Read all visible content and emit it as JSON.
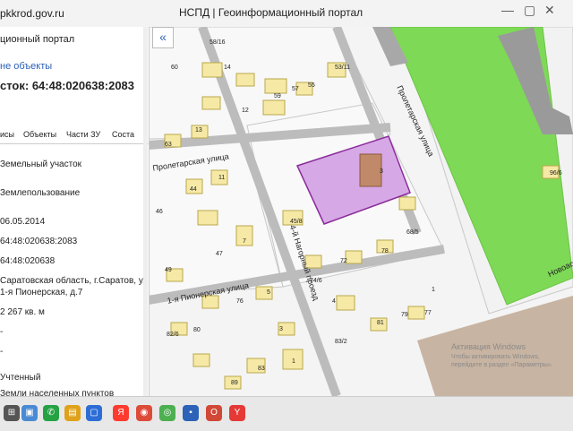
{
  "browser": {
    "url": "pkkrod.gov.ru",
    "title": "НСПД | Геоинформационный портал"
  },
  "panel": {
    "portal": "ционный портал",
    "objects_link": "не объекты",
    "cadastral": "сток: 64:48:020638:2083",
    "tabs": [
      "исы",
      "Объекты",
      "Части ЗУ",
      "Соста"
    ],
    "fields": [
      "Земельный участок",
      "Землепользование",
      "06.05.2014",
      "64:48:020638:2083",
      "64:48:020638",
      "Саратовская область, г.Саратов, ул.",
      "1-я Пионерская, д.7",
      "2 267 кв. м",
      "-",
      "-",
      "Учтенный",
      "Земли населенных пунктов"
    ]
  },
  "map": {
    "streets": [
      "Пролетарская улица",
      "Пролетарская улица",
      "1-я Пионерская улица",
      "4-й Нагорный проезд",
      "Новоас"
    ],
    "parcel_labels": [
      "58/16",
      "14",
      "60",
      "53/11",
      "59",
      "57",
      "55",
      "12",
      "13",
      "63",
      "11",
      "44",
      "3",
      "45/8",
      "46",
      "68/5",
      "7",
      "47",
      "72",
      "78",
      "49",
      "74/6",
      "4",
      "5",
      "1",
      "76",
      "81",
      "79",
      "77",
      "82/6",
      "80",
      "3",
      "83/2",
      "89",
      "83",
      "1",
      "2",
      "96/6"
    ],
    "highlight_label": "3"
  },
  "watermark": [
    "Активация Windows",
    "Чтобы активировать Windows, перейдите в раздел «Параметры»."
  ],
  "colors": {
    "park": "#7ed957",
    "parcel": "#f6e9a6",
    "selected": "#d7a8e6",
    "accent": "#2b5fb8"
  }
}
